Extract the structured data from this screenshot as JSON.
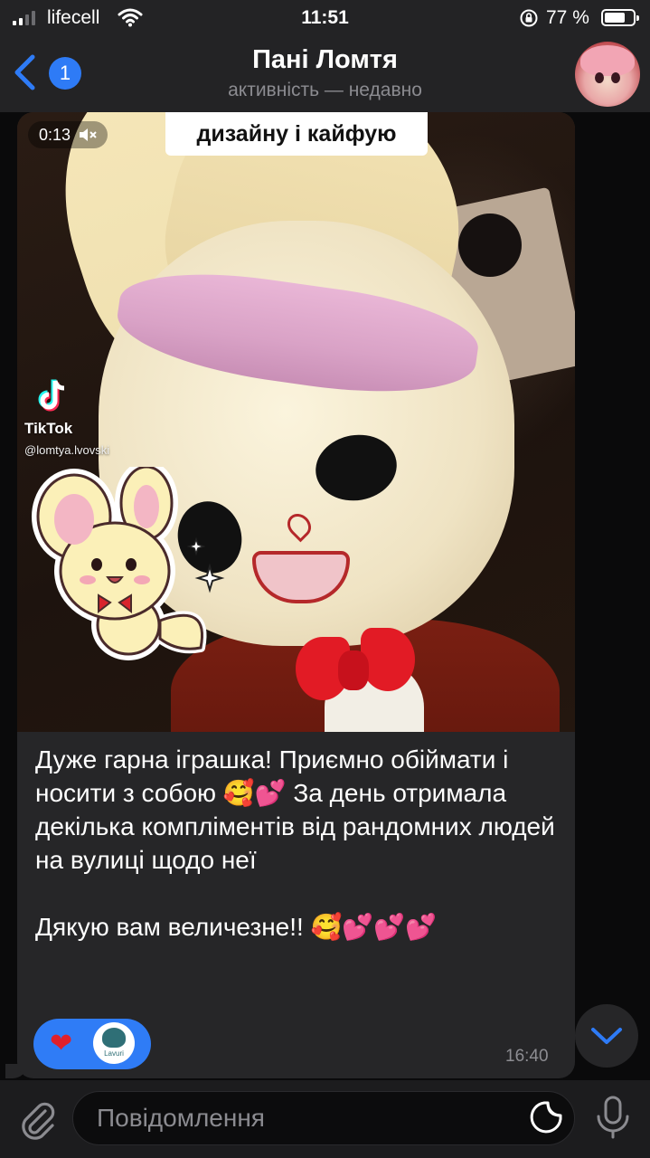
{
  "status_bar": {
    "carrier": "lifecell",
    "time": "11:51",
    "battery_percent": "77 %",
    "battery_level": 0.77
  },
  "header": {
    "back_badge_count": "1",
    "title": "Пані Ломтя",
    "subtitle": "активність — недавно"
  },
  "message": {
    "video_duration": "0:13",
    "video_caption": "дизайну і кайфую",
    "tiktok_label": "TikTok",
    "tiktok_handle": "@lomtya.lvovski",
    "text": "Дуже гарна іграшка! Приємно обіймати і носити з собою 🥰💕 За день отримала декілька компліментів від рандомних людей на вулиці щодо неї\n\nДякую вам величезне!! 🥰💕💕💕",
    "reaction_emoji": "❤",
    "reactor_brand": "Lavuri",
    "time": "16:40"
  },
  "input": {
    "placeholder": "Повідомлення"
  },
  "colors": {
    "accent": "#2e7bf6",
    "bubble": "#262628",
    "background": "#0a0a0b"
  },
  "icons": [
    "signal-icon",
    "wifi-icon",
    "rotation-lock-icon",
    "battery-icon",
    "back-chevron-icon",
    "mute-icon",
    "tiktok-icon",
    "heart-icon",
    "chevron-down-icon",
    "paperclip-icon",
    "sticker-icon",
    "microphone-icon"
  ]
}
